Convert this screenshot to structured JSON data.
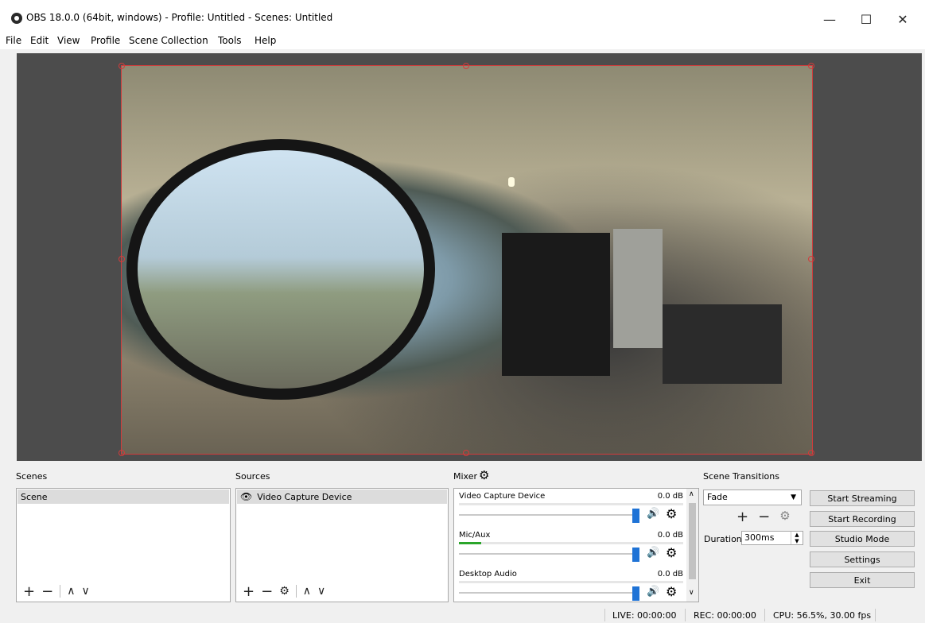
{
  "window": {
    "title": "OBS 18.0.0 (64bit, windows) - Profile: Untitled - Scenes: Untitled",
    "controls": {
      "minimize": "—",
      "maximize": "☐",
      "close": "✕"
    }
  },
  "menu": [
    "File",
    "Edit",
    "View",
    "Profile",
    "Scene Collection",
    "Tools",
    "Help"
  ],
  "scenes": {
    "label": "Scenes",
    "items": [
      "Scene"
    ]
  },
  "sources": {
    "label": "Sources",
    "items": [
      {
        "name": "Video Capture Device",
        "visible_icon": "eye-icon"
      }
    ]
  },
  "mixer": {
    "label": "Mixer",
    "tracks": [
      {
        "name": "Video Capture Device",
        "db": "0.0 dB",
        "level": 0
      },
      {
        "name": "Mic/Aux",
        "db": "0.0 dB",
        "level": 0.1
      },
      {
        "name": "Desktop Audio",
        "db": "0.0 dB",
        "level": 0
      }
    ]
  },
  "transitions": {
    "label": "Scene Transitions",
    "selected": "Fade",
    "duration_label": "Duration",
    "duration_value": "300ms"
  },
  "controls": {
    "start_streaming": "Start Streaming",
    "start_recording": "Start Recording",
    "studio_mode": "Studio Mode",
    "settings": "Settings",
    "exit": "Exit"
  },
  "status": {
    "live": "LIVE: 00:00:00",
    "rec": "REC: 00:00:00",
    "cpu": "CPU: 56.5%, 30.00 fps"
  },
  "colors": {
    "selection_border": "#d23b3b",
    "slider_thumb": "#1f73d6",
    "meter_green": "#2aa52a"
  }
}
